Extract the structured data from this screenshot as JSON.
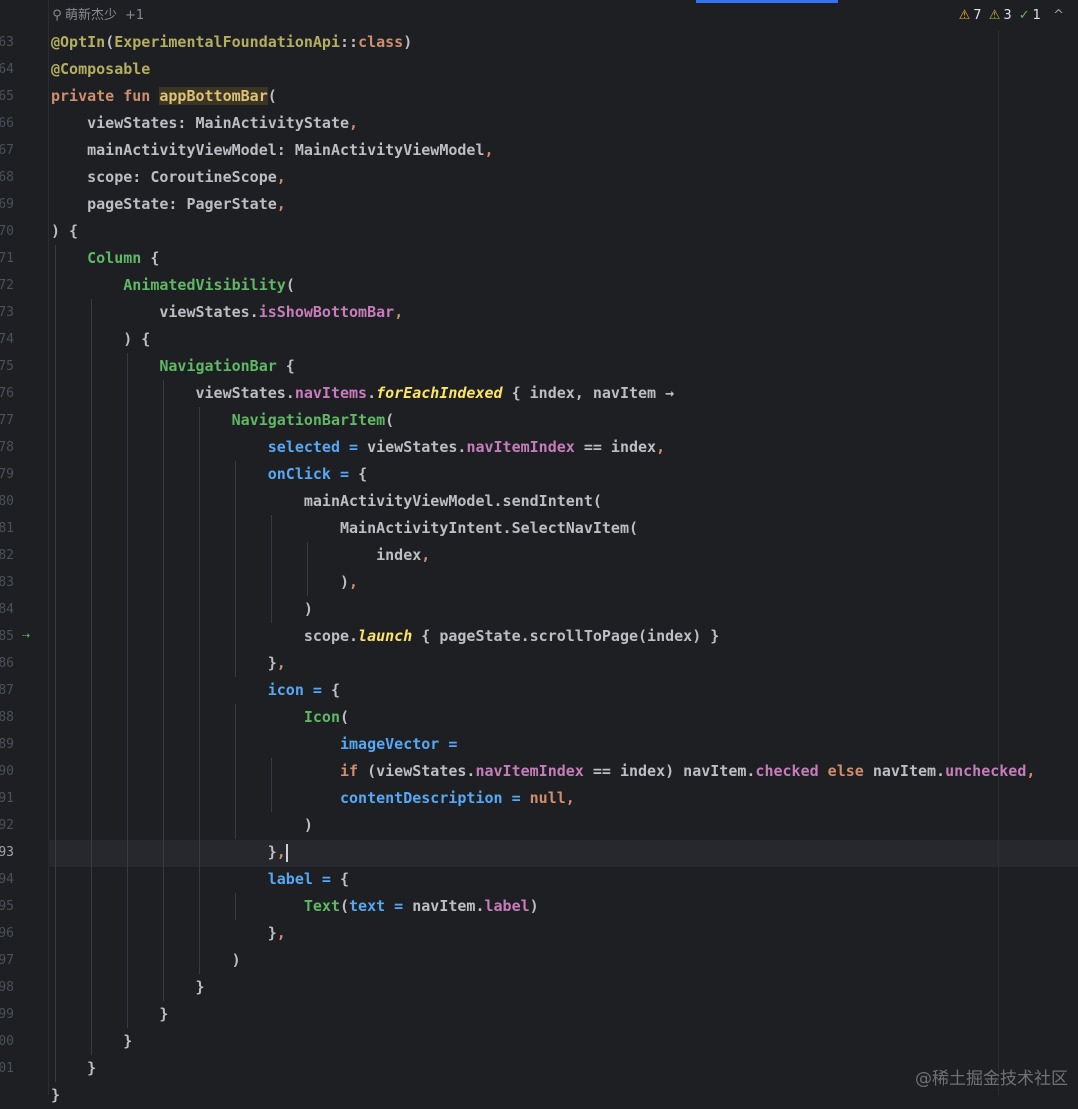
{
  "header": {
    "author": "萌新杰少",
    "author_extra": "+1",
    "warnings_count": "7",
    "weak_warnings_count": "3",
    "ok_count": "1",
    "nav_up": "^",
    "icons": [
      "person-icon",
      "warning-icon",
      "weak-warning-icon",
      "check-icon",
      "chevron-up-icon"
    ]
  },
  "gutter": {
    "line_numbers": [
      "63",
      "64",
      "65",
      "66",
      "67",
      "68",
      "69",
      "70",
      "71",
      "72",
      "73",
      "74",
      "75",
      "76",
      "77",
      "78",
      "79",
      "80",
      "81",
      "82",
      "83",
      "84",
      "85",
      "86",
      "87",
      "88",
      "89",
      "90",
      "91",
      "92",
      "93",
      "94",
      "95",
      "96",
      "97",
      "98",
      "99",
      "100",
      "101"
    ],
    "current_line": "93",
    "run_icon": "run-gutter-icon"
  },
  "code": {
    "lines": [
      [
        {
          "t": "@OptIn",
          "c": "ann"
        },
        {
          "t": "(",
          "c": "plain"
        },
        {
          "t": "ExperimentalFoundationApi",
          "c": "ann"
        },
        {
          "t": "::",
          "c": "plain"
        },
        {
          "t": "class",
          "c": "kw"
        },
        {
          "t": ")",
          "c": "plain"
        }
      ],
      [
        {
          "t": "@Composable",
          "c": "ann"
        }
      ],
      [
        {
          "t": "private fun ",
          "c": "kw"
        },
        {
          "t": "appBottomBar",
          "c": "fndecl"
        },
        {
          "t": "(",
          "c": "plain"
        }
      ],
      [
        {
          "t": "    viewStates: MainActivityState",
          "c": "plain"
        },
        {
          "t": ",",
          "c": "kw"
        }
      ],
      [
        {
          "t": "    mainActivityViewModel: MainActivityViewModel",
          "c": "plain"
        },
        {
          "t": ",",
          "c": "kw"
        }
      ],
      [
        {
          "t": "    scope: CoroutineScope",
          "c": "plain"
        },
        {
          "t": ",",
          "c": "kw"
        }
      ],
      [
        {
          "t": "    pageState: PagerState",
          "c": "plain"
        },
        {
          "t": ",",
          "c": "kw"
        }
      ],
      [
        {
          "t": ") {",
          "c": "plain"
        }
      ],
      [
        {
          "t": "    ",
          "c": "plain"
        },
        {
          "t": "Column",
          "c": "comp"
        },
        {
          "t": " {",
          "c": "plain"
        }
      ],
      [
        {
          "t": "        ",
          "c": "plain"
        },
        {
          "t": "AnimatedVisibility",
          "c": "comp"
        },
        {
          "t": "(",
          "c": "plain"
        }
      ],
      [
        {
          "t": "            viewStates.",
          "c": "plain"
        },
        {
          "t": "isShowBottomBar",
          "c": "prop"
        },
        {
          "t": ",",
          "c": "kw"
        }
      ],
      [
        {
          "t": "        ) {",
          "c": "plain"
        }
      ],
      [
        {
          "t": "            ",
          "c": "plain"
        },
        {
          "t": "NavigationBar",
          "c": "comp"
        },
        {
          "t": " {",
          "c": "plain"
        }
      ],
      [
        {
          "t": "                viewStates.",
          "c": "plain"
        },
        {
          "t": "navItems",
          "c": "prop"
        },
        {
          "t": ".",
          "c": "plain"
        },
        {
          "t": "forEachIndexed",
          "c": "ext"
        },
        {
          "t": " { index, navItem →",
          "c": "plain"
        }
      ],
      [
        {
          "t": "                    ",
          "c": "plain"
        },
        {
          "t": "NavigationBarItem",
          "c": "comp"
        },
        {
          "t": "(",
          "c": "plain"
        }
      ],
      [
        {
          "t": "                        ",
          "c": "plain"
        },
        {
          "t": "selected",
          "c": "named"
        },
        {
          "t": " = ",
          "c": "named"
        },
        {
          "t": "viewStates.",
          "c": "plain"
        },
        {
          "t": "navItemIndex",
          "c": "prop"
        },
        {
          "t": " == index",
          "c": "plain"
        },
        {
          "t": ",",
          "c": "kw"
        }
      ],
      [
        {
          "t": "                        ",
          "c": "plain"
        },
        {
          "t": "onClick",
          "c": "named"
        },
        {
          "t": " = ",
          "c": "named"
        },
        {
          "t": "{",
          "c": "plain"
        }
      ],
      [
        {
          "t": "                            mainActivityViewModel.sendIntent(",
          "c": "plain"
        }
      ],
      [
        {
          "t": "                                MainActivityIntent.SelectNavItem(",
          "c": "plain"
        }
      ],
      [
        {
          "t": "                                    index",
          "c": "plain"
        },
        {
          "t": ",",
          "c": "kw"
        }
      ],
      [
        {
          "t": "                                )",
          "c": "plain"
        },
        {
          "t": ",",
          "c": "kw"
        }
      ],
      [
        {
          "t": "                            )",
          "c": "plain"
        }
      ],
      [
        {
          "t": "                            scope.",
          "c": "plain"
        },
        {
          "t": "launch",
          "c": "ext"
        },
        {
          "t": " { pageState.scrollToPage(index) }",
          "c": "plain"
        }
      ],
      [
        {
          "t": "                        }",
          "c": "plain"
        },
        {
          "t": ",",
          "c": "kw"
        }
      ],
      [
        {
          "t": "                        ",
          "c": "plain"
        },
        {
          "t": "icon",
          "c": "named"
        },
        {
          "t": " = ",
          "c": "named"
        },
        {
          "t": "{",
          "c": "plain"
        }
      ],
      [
        {
          "t": "                            ",
          "c": "plain"
        },
        {
          "t": "Icon",
          "c": "comp"
        },
        {
          "t": "(",
          "c": "plain"
        }
      ],
      [
        {
          "t": "                                ",
          "c": "plain"
        },
        {
          "t": "imageVector",
          "c": "named"
        },
        {
          "t": " =",
          "c": "named"
        }
      ],
      [
        {
          "t": "                                ",
          "c": "plain"
        },
        {
          "t": "if",
          "c": "kw"
        },
        {
          "t": " (viewStates.",
          "c": "plain"
        },
        {
          "t": "navItemIndex",
          "c": "prop"
        },
        {
          "t": " == index) navItem.",
          "c": "plain"
        },
        {
          "t": "checked",
          "c": "prop"
        },
        {
          "t": " else ",
          "c": "kw"
        },
        {
          "t": "navItem.",
          "c": "plain"
        },
        {
          "t": "unchecked",
          "c": "prop"
        },
        {
          "t": ",",
          "c": "kw"
        }
      ],
      [
        {
          "t": "                                ",
          "c": "plain"
        },
        {
          "t": "contentDescription",
          "c": "named"
        },
        {
          "t": " = ",
          "c": "named"
        },
        {
          "t": "null",
          "c": "kw"
        },
        {
          "t": ",",
          "c": "kw"
        }
      ],
      [
        {
          "t": "                            )",
          "c": "plain"
        }
      ],
      [
        {
          "t": "                        }",
          "c": "plain"
        },
        {
          "t": ",",
          "c": "kw"
        },
        {
          "t": "",
          "c": "caret"
        }
      ],
      [
        {
          "t": "                        ",
          "c": "plain"
        },
        {
          "t": "label",
          "c": "named"
        },
        {
          "t": " = ",
          "c": "named"
        },
        {
          "t": "{",
          "c": "plain"
        }
      ],
      [
        {
          "t": "                            ",
          "c": "plain"
        },
        {
          "t": "Text",
          "c": "comp"
        },
        {
          "t": "(",
          "c": "plain"
        },
        {
          "t": "text",
          "c": "named"
        },
        {
          "t": " = ",
          "c": "named"
        },
        {
          "t": "navItem.",
          "c": "plain"
        },
        {
          "t": "label",
          "c": "prop"
        },
        {
          "t": ")",
          "c": "plain"
        }
      ],
      [
        {
          "t": "                        }",
          "c": "plain"
        },
        {
          "t": ",",
          "c": "kw"
        }
      ],
      [
        {
          "t": "                    )",
          "c": "plain"
        }
      ],
      [
        {
          "t": "                }",
          "c": "plain"
        }
      ],
      [
        {
          "t": "            }",
          "c": "plain"
        }
      ],
      [
        {
          "t": "        }",
          "c": "plain"
        }
      ],
      [
        {
          "t": "    }",
          "c": "plain"
        }
      ],
      [
        {
          "t": "}",
          "c": "plain"
        }
      ]
    ]
  },
  "watermark": "@稀土掘金技术社区"
}
